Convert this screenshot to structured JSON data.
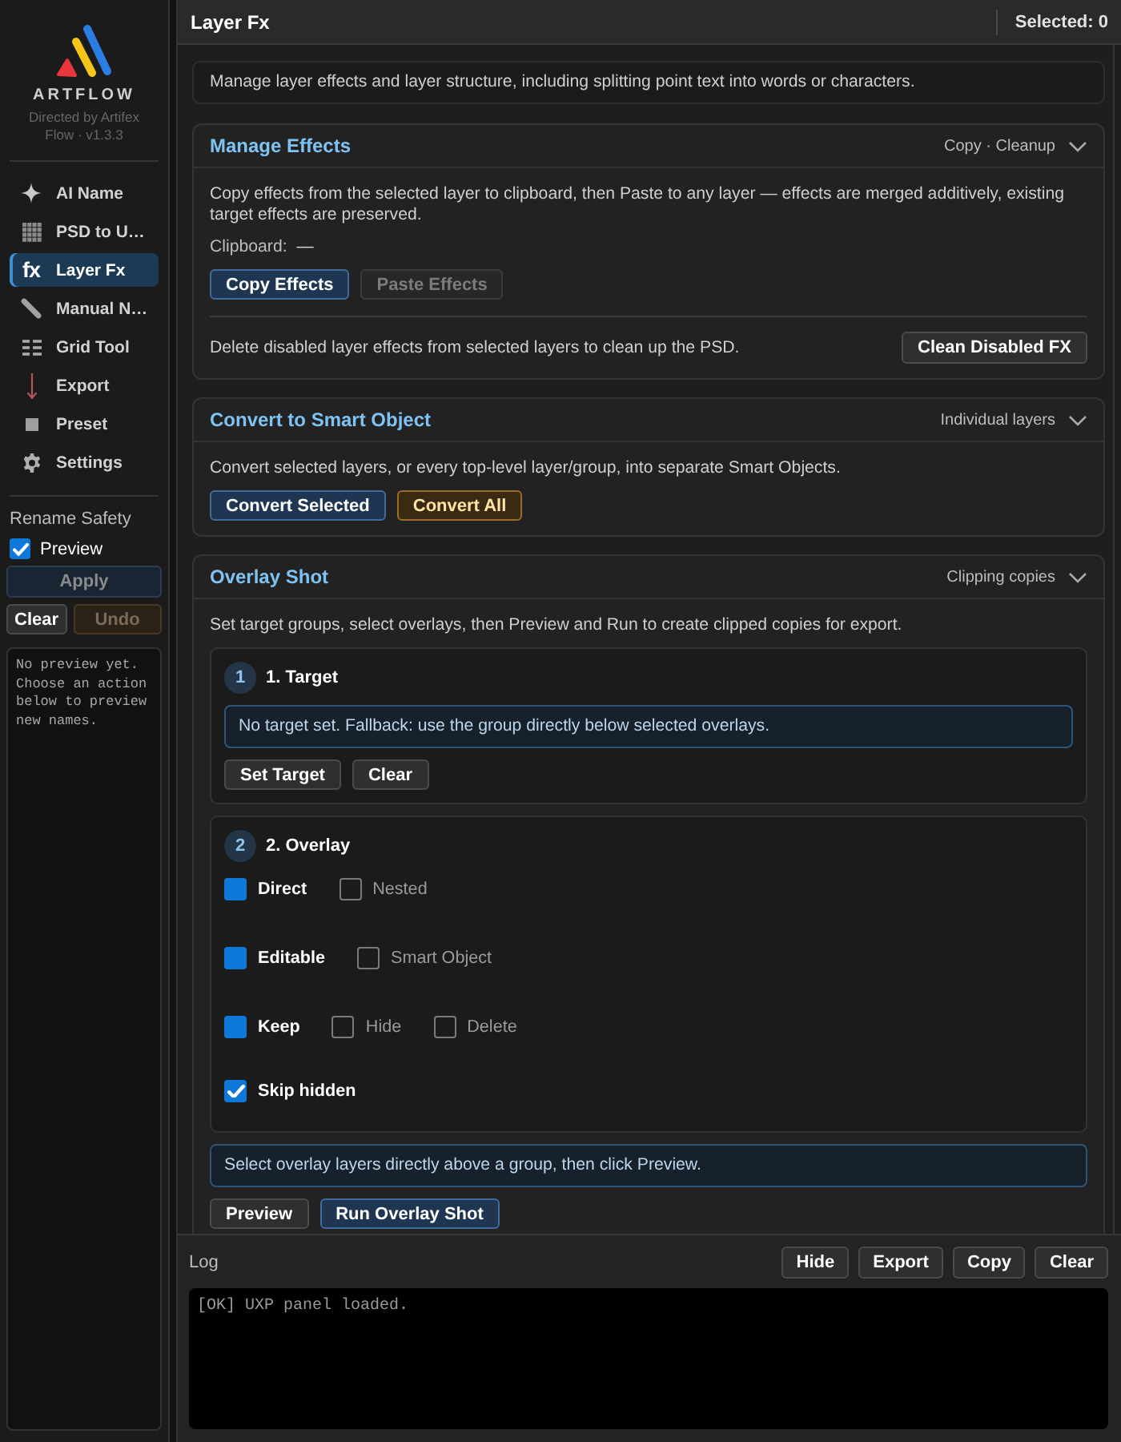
{
  "sidebar": {
    "brand": {
      "name": "ARTFLOW",
      "tagline": "Directed by Artifex Flow · v1.3.3"
    },
    "nav": [
      {
        "label": "AI Name",
        "selected": false
      },
      {
        "label": "PSD to U…",
        "selected": false
      },
      {
        "label": "Layer Fx",
        "icon_text": "fx",
        "selected": true
      },
      {
        "label": "Manual N…",
        "selected": false
      },
      {
        "label": "Grid Tool",
        "selected": false
      },
      {
        "label": "Export",
        "selected": false
      },
      {
        "label": "Preset",
        "selected": false
      },
      {
        "label": "Settings",
        "selected": false
      }
    ],
    "rename_safety": {
      "title": "Rename Safety",
      "preview": {
        "label": "Preview",
        "checked": true
      },
      "apply": {
        "label": "Apply",
        "kind": "primary",
        "disabled": true
      },
      "buttons": [
        {
          "label": "Clear",
          "kind": "default",
          "disabled": false
        },
        {
          "label": "Undo",
          "kind": "warning",
          "disabled": true
        }
      ],
      "output": "No preview yet. Choose an action below to preview new names."
    }
  },
  "header": {
    "title": "Layer Fx",
    "selection": "Selected: 0"
  },
  "intro": "Manage layer effects and layer structure, including splitting point text into words or characters.",
  "sections": [
    {
      "title": "Manage Effects",
      "summary": "Copy · Cleanup",
      "expanded": true,
      "blocks": [
        {
          "kind": "text",
          "text": "Copy effects from the selected layer to clipboard, then Paste to any layer — effects are merged additively, existing target effects are preserved."
        },
        {
          "kind": "pair",
          "label": "Clipboard:",
          "value": "—"
        },
        {
          "kind": "buttons",
          "buttons": [
            {
              "label": "Copy Effects",
              "kind": "primary",
              "disabled": false
            },
            {
              "label": "Paste Effects",
              "kind": "default",
              "disabled": true
            }
          ]
        },
        {
          "kind": "action_row",
          "text": "Delete disabled layer effects from selected layers to clean up the PSD.",
          "button": {
            "label": "Clean Disabled FX",
            "kind": "default",
            "disabled": false
          }
        }
      ]
    },
    {
      "title": "Convert to Smart Object",
      "summary": "Individual layers",
      "expanded": true,
      "blocks": [
        {
          "kind": "text",
          "text": "Convert selected layers, or every top-level layer/group, into separate Smart Objects."
        },
        {
          "kind": "buttons",
          "buttons": [
            {
              "label": "Convert Selected",
              "kind": "primary",
              "disabled": false
            },
            {
              "label": "Convert All",
              "kind": "warning",
              "disabled": false
            }
          ]
        }
      ]
    },
    {
      "title": "Overlay Shot",
      "summary": "Clipping copies",
      "expanded": true,
      "blocks": [
        {
          "kind": "text",
          "text": "Set target groups, select overlays, then Preview and Run to create clipped copies for export."
        },
        {
          "kind": "step",
          "number": "1",
          "title": "1. Target",
          "blocks": [
            {
              "kind": "note",
              "text": "No target set. Fallback: use the group directly below selected overlays."
            },
            {
              "kind": "buttons",
              "buttons": [
                {
                  "label": "Set Target",
                  "kind": "default",
                  "disabled": false
                },
                {
                  "label": "Clear",
                  "kind": "default",
                  "disabled": false
                }
              ]
            }
          ]
        },
        {
          "kind": "step",
          "number": "2",
          "title": "2. Overlay",
          "blocks": [
            {
              "kind": "choice",
              "options": [
                {
                  "label": "Direct",
                  "selected": true
                },
                {
                  "label": "Nested",
                  "selected": false
                }
              ]
            },
            {
              "kind": "choice",
              "options": [
                {
                  "label": "Editable",
                  "selected": true
                },
                {
                  "label": "Smart Object",
                  "selected": false
                }
              ]
            },
            {
              "kind": "choice",
              "options": [
                {
                  "label": "Keep",
                  "selected": true
                },
                {
                  "label": "Hide",
                  "selected": false
                },
                {
                  "label": "Delete",
                  "selected": false
                }
              ]
            },
            {
              "kind": "check",
              "label": "Skip hidden",
              "checked": true
            }
          ]
        },
        {
          "kind": "note",
          "text": "Select overlay layers directly above a group, then click Preview."
        },
        {
          "kind": "buttons",
          "buttons": [
            {
              "label": "Preview",
              "kind": "default",
              "disabled": false
            },
            {
              "label": "Run Overlay Shot",
              "kind": "primary",
              "disabled": false
            }
          ]
        }
      ]
    }
  ],
  "log": {
    "title": "Log",
    "buttons": [
      {
        "label": "Hide",
        "kind": "default",
        "disabled": false
      },
      {
        "label": "Export",
        "kind": "default",
        "disabled": false
      },
      {
        "label": "Copy",
        "kind": "default",
        "disabled": false
      },
      {
        "label": "Clear",
        "kind": "default",
        "disabled": false
      }
    ],
    "lines": [
      "[OK] UXP panel loaded."
    ]
  }
}
